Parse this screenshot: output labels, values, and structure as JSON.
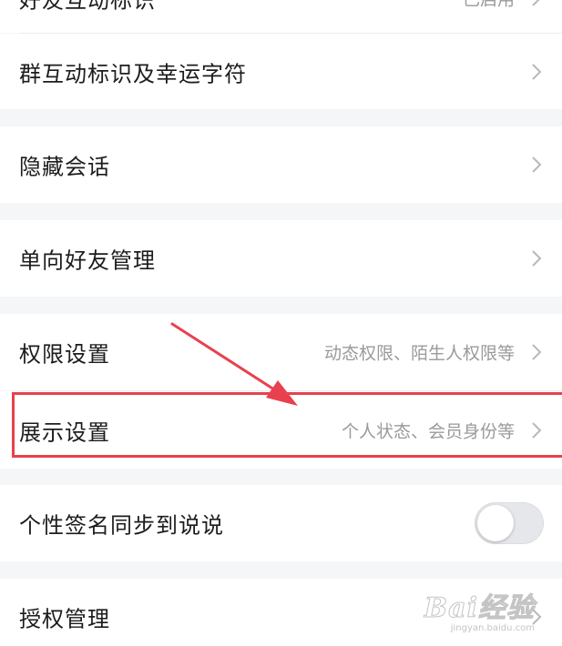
{
  "rows": [
    {
      "title": "好友互动标识",
      "subtitle": "已启用"
    },
    {
      "title": "群互动标识及幸运字符"
    },
    {
      "title": "隐藏会话"
    },
    {
      "title": "单向好友管理"
    },
    {
      "title": "权限设置",
      "subtitle": "动态权限、陌生人权限等"
    },
    {
      "title": "展示设置",
      "subtitle": "个人状态、会员身份等"
    },
    {
      "title": "个性签名同步到说说",
      "toggle_on": false
    },
    {
      "title": "授权管理"
    }
  ],
  "annotation": {
    "highlight_color": "#e8414d"
  },
  "watermark": {
    "logo": "Bai经验",
    "url": "jingyan.baidu.com"
  }
}
